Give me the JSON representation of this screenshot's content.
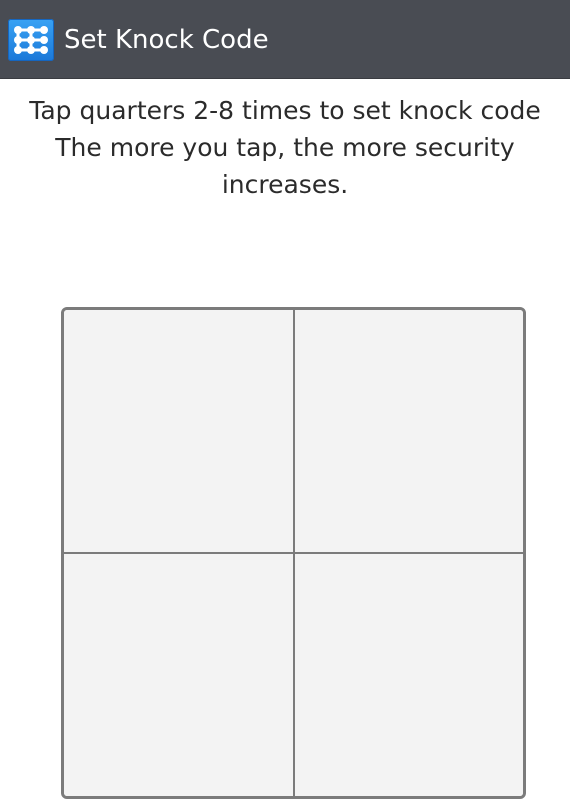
{
  "action_bar": {
    "icon": "knock-code-grid-icon",
    "title": "Set Knock Code"
  },
  "instructions": {
    "lines": [
      "Tap quarters 2-8 times to set knock code",
      "The more you tap, the more security",
      "increases."
    ]
  },
  "knock_pad": {
    "quadrants": [
      "top-left",
      "top-right",
      "bottom-left",
      "bottom-right"
    ]
  },
  "colors": {
    "action_bar": "#494c53",
    "icon_blue": "#2a8ee8",
    "pad_fill": "#f3f3f3",
    "pad_border": "#7b7b7b",
    "text": "#2b2b2b"
  }
}
